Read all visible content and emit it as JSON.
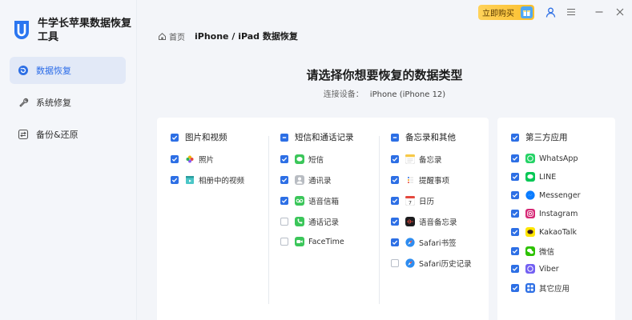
{
  "app": {
    "title": "牛学长苹果数据恢复工具"
  },
  "sidebar": {
    "items": [
      {
        "label": "数据恢复",
        "active": true
      },
      {
        "label": "系统修复",
        "active": false
      },
      {
        "label": "备份&还原",
        "active": false
      }
    ]
  },
  "topbar": {
    "buy_label": "立即购买"
  },
  "breadcrumb": {
    "home": "首页",
    "current": "iPhone / iPad 数据恢复"
  },
  "header": {
    "title": "请选择你想要恢复的数据类型",
    "device_label": "连接设备：",
    "device_value": "iPhone (iPhone 12)"
  },
  "groups": {
    "media": {
      "label": "图片和视频",
      "state": "checked",
      "items": [
        {
          "label": "照片",
          "checked": true,
          "icon": "photos-icon"
        },
        {
          "label": "相册中的视频",
          "checked": true,
          "icon": "video-icon"
        }
      ]
    },
    "messages": {
      "label": "短信和通话记录",
      "state": "partial",
      "items": [
        {
          "label": "短信",
          "checked": true,
          "icon": "messages-icon"
        },
        {
          "label": "通讯录",
          "checked": true,
          "icon": "contacts-icon"
        },
        {
          "label": "语音信箱",
          "checked": true,
          "icon": "voicemail-icon"
        },
        {
          "label": "通话记录",
          "checked": false,
          "icon": "phone-icon"
        },
        {
          "label": "FaceTime",
          "checked": false,
          "icon": "facetime-icon"
        }
      ]
    },
    "memos": {
      "label": "备忘录和其他",
      "state": "partial",
      "items": [
        {
          "label": "备忘录",
          "checked": true,
          "icon": "notes-icon"
        },
        {
          "label": "提醒事项",
          "checked": true,
          "icon": "reminders-icon"
        },
        {
          "label": "日历",
          "checked": true,
          "icon": "calendar-icon"
        },
        {
          "label": "语音备忘录",
          "checked": true,
          "icon": "voice-memo-icon"
        },
        {
          "label": "Safari书签",
          "checked": true,
          "icon": "safari-icon"
        },
        {
          "label": "Safari历史记录",
          "checked": false,
          "icon": "safari-icon"
        }
      ]
    },
    "third_party": {
      "label": "第三方应用",
      "state": "checked",
      "items": [
        {
          "label": "WhatsApp",
          "checked": true,
          "icon": "whatsapp-icon"
        },
        {
          "label": "LINE",
          "checked": true,
          "icon": "line-icon"
        },
        {
          "label": "Messenger",
          "checked": true,
          "icon": "messenger-icon"
        },
        {
          "label": "Instagram",
          "checked": true,
          "icon": "instagram-icon"
        },
        {
          "label": "KakaoTalk",
          "checked": true,
          "icon": "kakaotalk-icon"
        },
        {
          "label": "微信",
          "checked": true,
          "icon": "wechat-icon"
        },
        {
          "label": "Viber",
          "checked": true,
          "icon": "viber-icon"
        },
        {
          "label": "其它应用",
          "checked": true,
          "icon": "other-apps-icon"
        }
      ]
    }
  },
  "colors": {
    "accent": "#2d6fe5",
    "sidebar_active_bg": "#e2e9f7",
    "buy_button": "#fbbf2d"
  }
}
